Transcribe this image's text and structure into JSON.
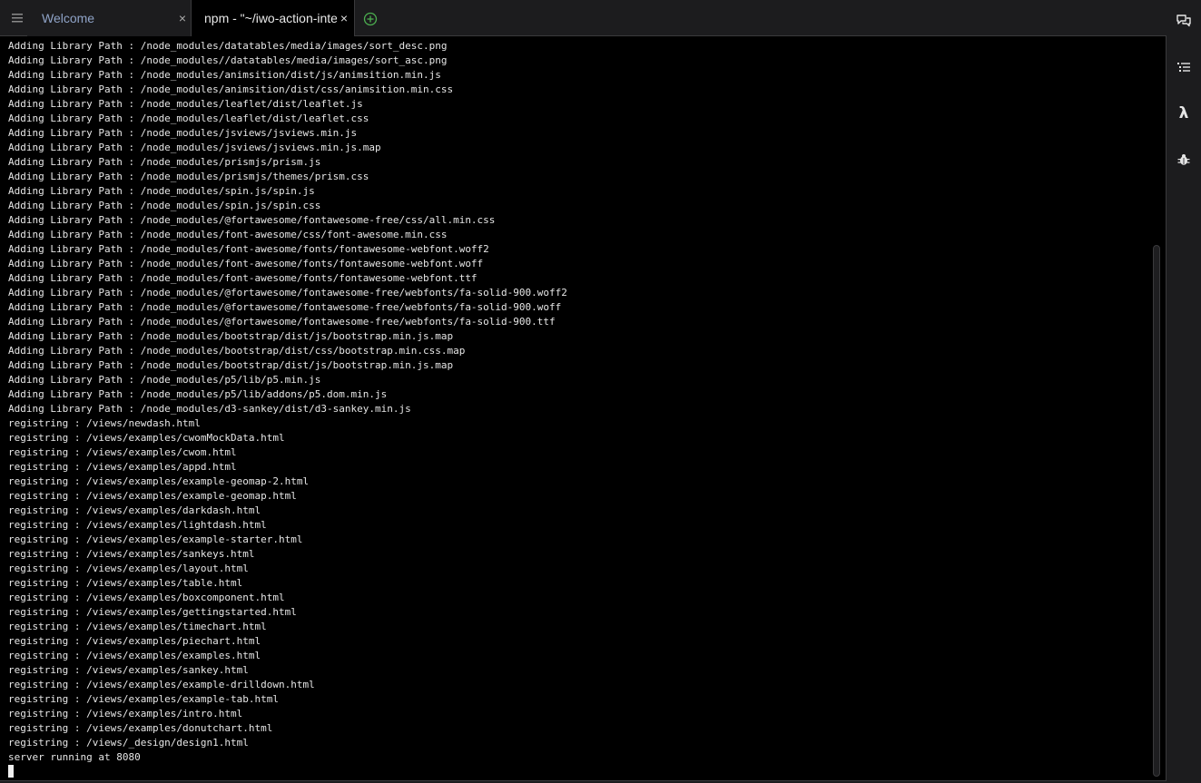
{
  "tabs": [
    {
      "label": "Welcome",
      "close": "×",
      "active": false
    },
    {
      "label": "npm - \"~/iwo-action-integ",
      "close": "×",
      "active": true
    }
  ],
  "sidebar_icons": [
    "chat-icon",
    "list-icon",
    "lambda-icon",
    "bug-icon"
  ],
  "sidebar_lambda_glyph": "λ",
  "terminal": {
    "lines": [
      "Adding Library Path : /node_modules/datatables/media/images/sort_desc.png",
      "Adding Library Path : /node_modules//datatables/media/images/sort_asc.png",
      "Adding Library Path : /node_modules/animsition/dist/js/animsition.min.js",
      "Adding Library Path : /node_modules/animsition/dist/css/animsition.min.css",
      "Adding Library Path : /node_modules/leaflet/dist/leaflet.js",
      "Adding Library Path : /node_modules/leaflet/dist/leaflet.css",
      "Adding Library Path : /node_modules/jsviews/jsviews.min.js",
      "Adding Library Path : /node_modules/jsviews/jsviews.min.js.map",
      "Adding Library Path : /node_modules/prismjs/prism.js",
      "Adding Library Path : /node_modules/prismjs/themes/prism.css",
      "Adding Library Path : /node_modules/spin.js/spin.js",
      "Adding Library Path : /node_modules/spin.js/spin.css",
      "Adding Library Path : /node_modules/@fortawesome/fontawesome-free/css/all.min.css",
      "Adding Library Path : /node_modules/font-awesome/css/font-awesome.min.css",
      "Adding Library Path : /node_modules/font-awesome/fonts/fontawesome-webfont.woff2",
      "Adding Library Path : /node_modules/font-awesome/fonts/fontawesome-webfont.woff",
      "Adding Library Path : /node_modules/font-awesome/fonts/fontawesome-webfont.ttf",
      "Adding Library Path : /node_modules/@fortawesome/fontawesome-free/webfonts/fa-solid-900.woff2",
      "Adding Library Path : /node_modules/@fortawesome/fontawesome-free/webfonts/fa-solid-900.woff",
      "Adding Library Path : /node_modules/@fortawesome/fontawesome-free/webfonts/fa-solid-900.ttf",
      "Adding Library Path : /node_modules/bootstrap/dist/js/bootstrap.min.js.map",
      "Adding Library Path : /node_modules/bootstrap/dist/css/bootstrap.min.css.map",
      "Adding Library Path : /node_modules/bootstrap/dist/js/bootstrap.min.js.map",
      "Adding Library Path : /node_modules/p5/lib/p5.min.js",
      "Adding Library Path : /node_modules/p5/lib/addons/p5.dom.min.js",
      "Adding Library Path : /node_modules/d3-sankey/dist/d3-sankey.min.js",
      "registring : /views/newdash.html",
      "registring : /views/examples/cwomMockData.html",
      "registring : /views/examples/cwom.html",
      "registring : /views/examples/appd.html",
      "registring : /views/examples/example-geomap-2.html",
      "registring : /views/examples/example-geomap.html",
      "registring : /views/examples/darkdash.html",
      "registring : /views/examples/lightdash.html",
      "registring : /views/examples/example-starter.html",
      "registring : /views/examples/sankeys.html",
      "registring : /views/examples/layout.html",
      "registring : /views/examples/table.html",
      "registring : /views/examples/boxcomponent.html",
      "registring : /views/examples/gettingstarted.html",
      "registring : /views/examples/timechart.html",
      "registring : /views/examples/piechart.html",
      "registring : /views/examples/examples.html",
      "registring : /views/examples/sankey.html",
      "registring : /views/examples/example-drilldown.html",
      "registring : /views/examples/example-tab.html",
      "registring : /views/examples/intro.html",
      "registring : /views/examples/donutchart.html",
      "registring : /views/_design/design1.html",
      "server running at 8080"
    ]
  }
}
